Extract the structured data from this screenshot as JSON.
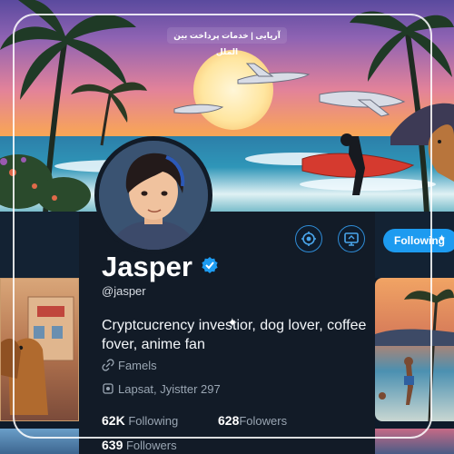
{
  "banner": {
    "text": "آرپایی | خدمات پرداخت بین الملل"
  },
  "profile": {
    "name": "Jasper",
    "handle": "@jasper",
    "bio": "Cryptcucrency investior, dog lover, coffee fover, anime fan",
    "meta_link": "Famels",
    "meta_location": "Lapsat, Jyistter 297"
  },
  "actions": {
    "follow_label": "Following"
  },
  "stats": {
    "following_count": "62K",
    "following_label": "Following",
    "followers_b_count": "628",
    "followers_b_label": "Folowers",
    "followers_count": "639",
    "followers_label": "Followers"
  },
  "colors": {
    "accent": "#1d9bf0",
    "background": "#121b27",
    "verified": "#1d9bf0"
  },
  "icons": [
    "verified-icon",
    "settings-icon",
    "monitor-icon",
    "link-icon",
    "location-icon"
  ]
}
